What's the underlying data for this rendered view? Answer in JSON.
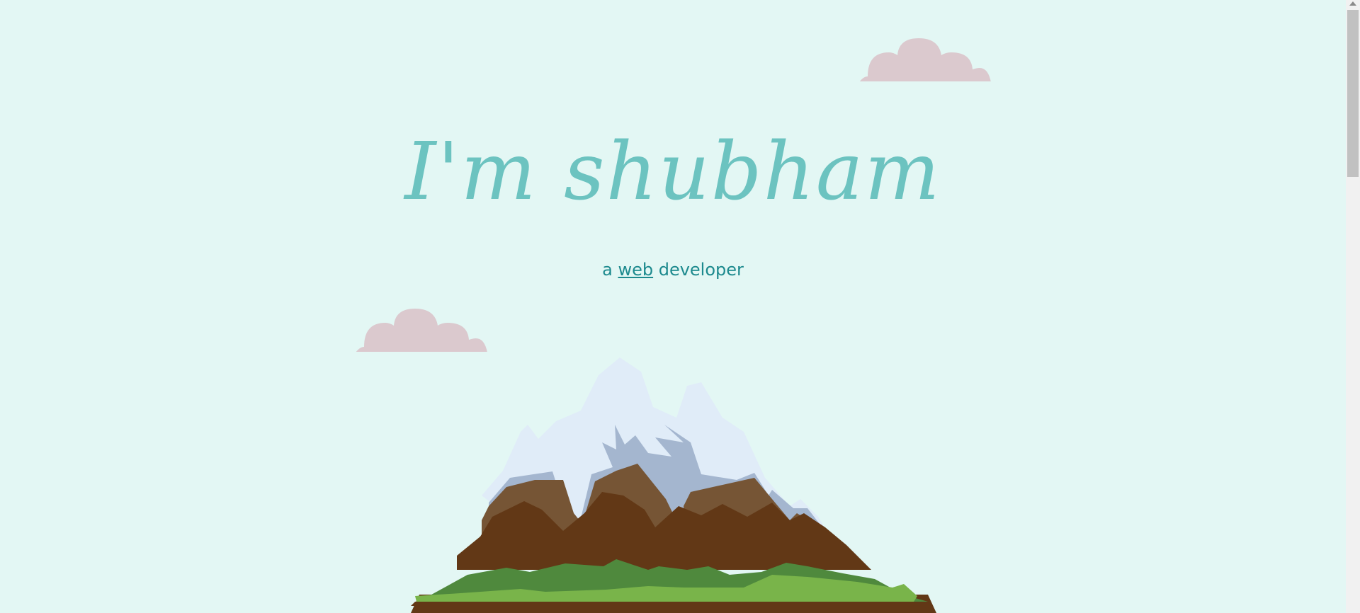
{
  "hero": {
    "title": "I'm shubham",
    "subtitle_prefix": "a ",
    "subtitle_link": "web",
    "subtitle_suffix": " developer"
  },
  "icons": {
    "cloud": "cloud-icon",
    "mountain": "mountain-illustration"
  },
  "colors": {
    "background": "#e3f7f4",
    "title": "#6cc3c0",
    "subtitle": "#1d8a8e",
    "cloud": "#dbc9ce",
    "snow": "#e0ecf8",
    "rock_shadow": "#a4b6cf",
    "rock_light": "#765535",
    "rock_dark": "#623816",
    "grass_dark": "#4f893d",
    "grass_light": "#79b44a"
  }
}
